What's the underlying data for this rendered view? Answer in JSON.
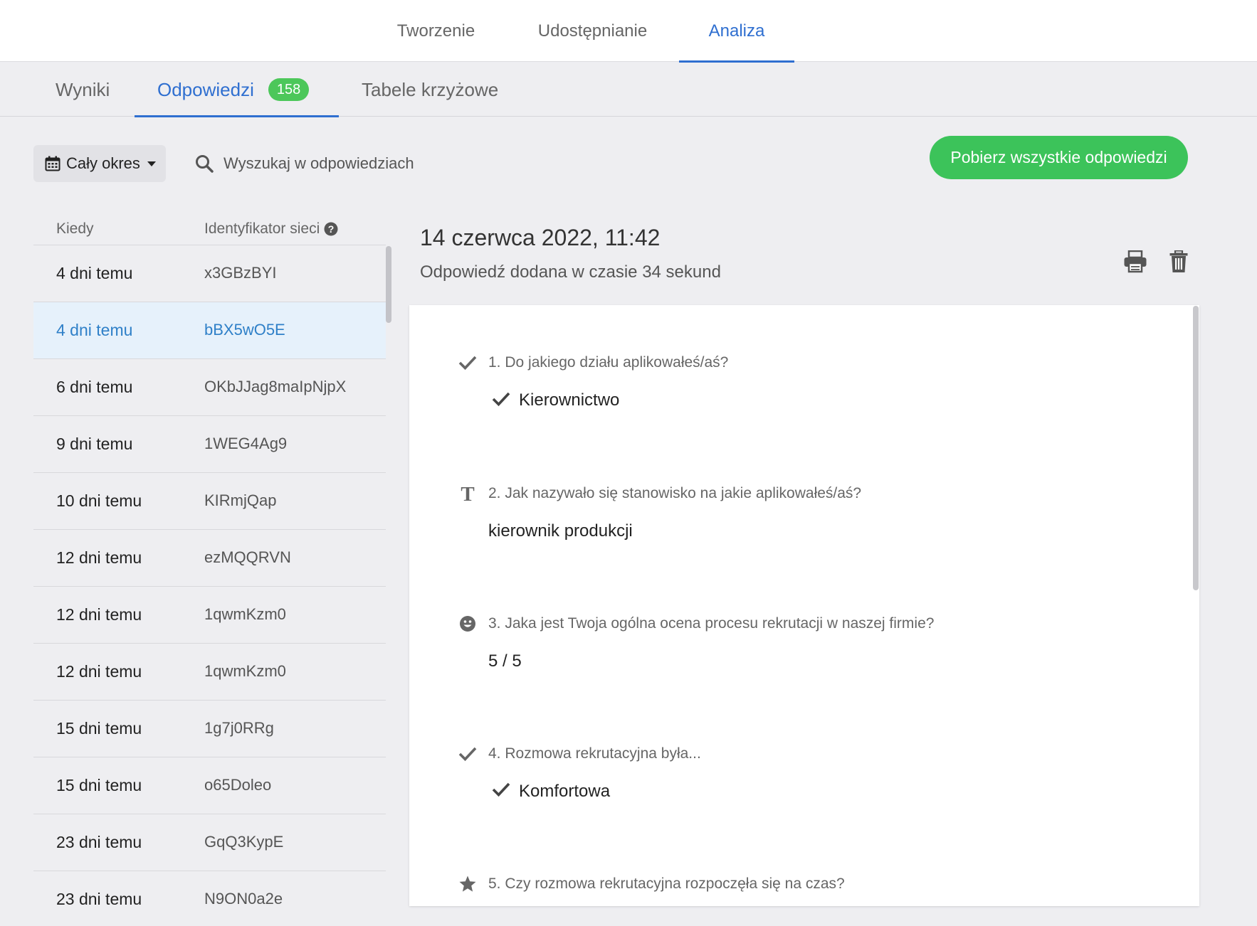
{
  "top_tabs": [
    {
      "label": "Tworzenie"
    },
    {
      "label": "Udostępnianie"
    },
    {
      "label": "Analiza"
    }
  ],
  "sub_tabs": {
    "results": "Wyniki",
    "responses": "Odpowiedzi",
    "responses_count": "158",
    "crosstabs": "Tabele krzyżowe"
  },
  "toolbar": {
    "period_label": "Cały okres",
    "search_placeholder": "Wyszukaj w odpowiedziach",
    "download_label": "Pobierz wszystkie odpowiedzi"
  },
  "list": {
    "col_when": "Kiedy",
    "col_id": "Identyfikator sieci",
    "rows": [
      {
        "when": "4 dni temu",
        "id": "x3GBzBYI"
      },
      {
        "when": "4 dni temu",
        "id": "bBX5wO5E"
      },
      {
        "when": "6 dni temu",
        "id": "OKbJJag8maIpNjpX"
      },
      {
        "when": "9 dni temu",
        "id": "1WEG4Ag9"
      },
      {
        "when": "10 dni temu",
        "id": "KIRmjQap"
      },
      {
        "when": "12 dni temu",
        "id": "ezMQQRVN"
      },
      {
        "when": "12 dni temu",
        "id": "1qwmKzm0"
      },
      {
        "when": "12 dni temu",
        "id": "1qwmKzm0"
      },
      {
        "when": "15 dni temu",
        "id": "1g7j0RRg"
      },
      {
        "when": "15 dni temu",
        "id": "o65Doleo"
      },
      {
        "when": "23 dni temu",
        "id": "GqQ3KypE"
      },
      {
        "when": "23 dni temu",
        "id": "N9ON0a2e"
      }
    ]
  },
  "detail": {
    "date": "14 czerwca 2022, 11:42",
    "subtitle": "Odpowiedź dodana w czasie 34 sekund",
    "questions": [
      {
        "icon": "check-icon",
        "text": "1. Do jakiego działu aplikowałeś/aś?",
        "answer": "Kierownictwo"
      },
      {
        "icon": "text-icon",
        "text": "2. Jak nazywało się stanowisko na jakie aplikowałeś/aś?",
        "answer": "kierownik produkcji"
      },
      {
        "icon": "smiley-icon",
        "text": "3. Jaka jest Twoja ogólna ocena procesu rekrutacji w naszej firmie?",
        "answer": "5 / 5"
      },
      {
        "icon": "check-icon",
        "text": "4. Rozmowa rekrutacyjna była...",
        "answer": "Komfortowa"
      },
      {
        "icon": "star-icon",
        "text": "5. Czy rozmowa rekrutacyjna rozpoczęła się na czas?",
        "answer": ""
      }
    ]
  },
  "colors": {
    "accent": "#2f6fd0",
    "green": "#3cc35a",
    "badge": "#4cc75a",
    "selected_row": "#e6f1fb"
  }
}
